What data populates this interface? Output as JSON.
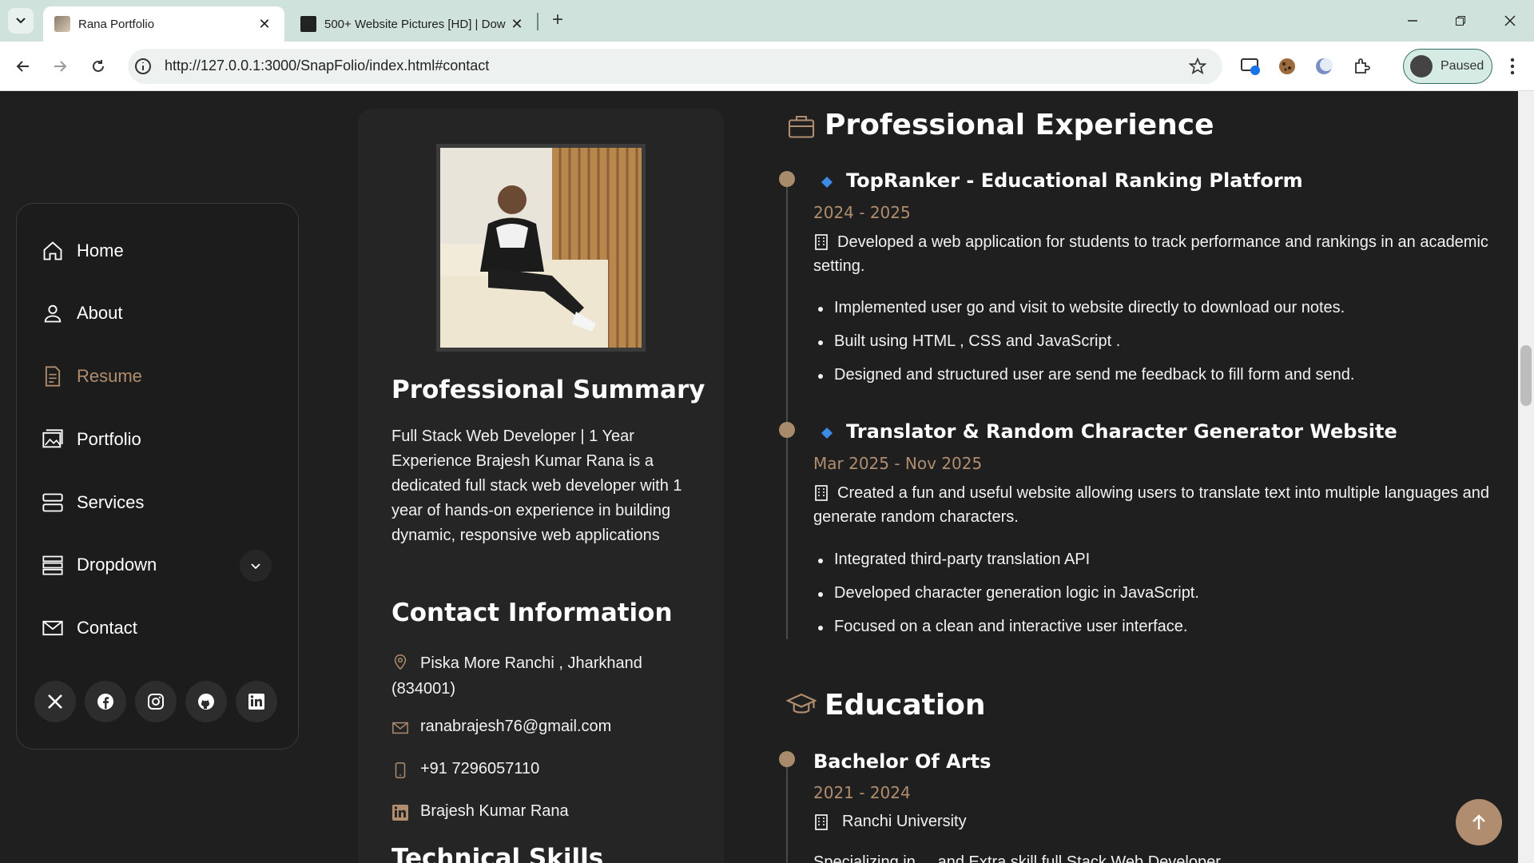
{
  "browser": {
    "tabs": [
      {
        "title": "Rana Portfolio",
        "active": true
      },
      {
        "title": "500+ Website Pictures [HD] | Dow",
        "active": false
      }
    ],
    "url": "http://127.0.0.1:3000/SnapFolio/index.html#contact",
    "profile_label": "Paused"
  },
  "sidebar": {
    "items": [
      {
        "label": "Home",
        "icon": "house-icon"
      },
      {
        "label": "About",
        "icon": "person-icon"
      },
      {
        "label": "Resume",
        "icon": "file-icon",
        "active": true
      },
      {
        "label": "Portfolio",
        "icon": "images-icon"
      },
      {
        "label": "Services",
        "icon": "server-icon"
      },
      {
        "label": "Dropdown",
        "icon": "menu-icon"
      },
      {
        "label": "Contact",
        "icon": "envelope-icon"
      }
    ],
    "socials": [
      "x-icon",
      "facebook-icon",
      "instagram-icon",
      "github-icon",
      "linkedin-icon"
    ]
  },
  "summary": {
    "heading": "Professional Summary",
    "text": "Full Stack Web Developer | 1 Year Experience Brajesh Kumar Rana is a dedicated full stack web developer with 1 year of hands-on experience in building dynamic, responsive web applications"
  },
  "contact": {
    "heading": "Contact Information",
    "address": "Piska More Ranchi , Jharkhand (834001)",
    "email": "ranabrajesh76@gmail.com",
    "phone": "+91 7296057110",
    "linkedin": "Brajesh Kumar Rana",
    "next_heading": "Technical Skills"
  },
  "experience": {
    "heading": "Professional Experience",
    "jobs": [
      {
        "title": "TopRanker - Educational Ranking Platform",
        "date": "2024 - 2025",
        "desc": "Developed a web application for students to track performance and rankings in an academic setting.",
        "bullets": [
          "Implemented user go and visit to website directly to download our notes.",
          "Built using HTML , CSS and JavaScript .",
          "Designed and structured user are send me feedback to fill form and send."
        ]
      },
      {
        "title": "Translator & Random Character Generator Website",
        "date": "Mar 2025 - Nov 2025",
        "desc": "Created a fun and useful website allowing users to translate text into multiple languages and generate random characters.",
        "bullets": [
          "Integrated third-party translation API",
          "Developed character generation logic in JavaScript.",
          "Focused on a clean and interactive user interface."
        ]
      }
    ]
  },
  "education": {
    "heading": "Education",
    "degree": "Bachelor Of Arts",
    "date": "2021 - 2024",
    "school": "Ranchi University",
    "partial": "Specializing in ... and Extra skill full Stack Web Developer"
  },
  "colors": {
    "accent": "#b08d6e",
    "bg": "#1f1f1f",
    "card": "#252525"
  }
}
